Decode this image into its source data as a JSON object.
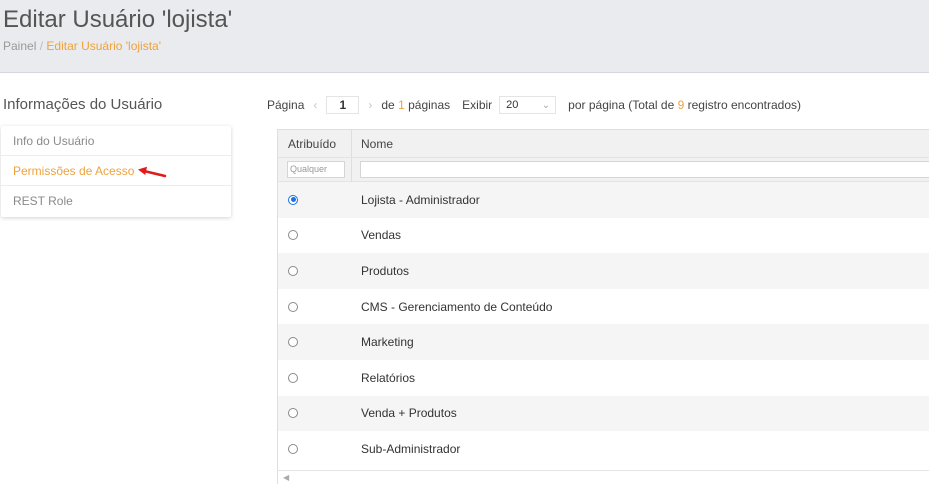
{
  "header": {
    "title": "Editar Usuário 'lojista'",
    "breadcrumb": [
      {
        "label": "Painel"
      },
      {
        "label": "Editar Usuário 'lojista'"
      }
    ],
    "separator": "/"
  },
  "sidebar": {
    "title": "Informações do Usuário",
    "items": [
      {
        "label": "Info do Usuário",
        "active": false
      },
      {
        "label": "Permissões de Acesso",
        "active": true
      },
      {
        "label": "REST Role",
        "active": false
      }
    ]
  },
  "pager": {
    "page_label": "Página",
    "current_page": "1",
    "of_label": "de",
    "total_pages": "1",
    "pages_label": "páginas",
    "show_label": "Exibir",
    "per_page": "20",
    "per_page_label": "por página (Total de",
    "total_records": "9",
    "records_label": "registro encontrados)"
  },
  "grid": {
    "columns": [
      "Atribuído",
      "Nome"
    ],
    "filter_placeholder": "Qualquer",
    "rows": [
      {
        "name": "Lojista - Administrador",
        "assigned": true
      },
      {
        "name": "Vendas",
        "assigned": false
      },
      {
        "name": "Produtos",
        "assigned": false
      },
      {
        "name": "CMS - Gerenciamento de Conteúdo",
        "assigned": false
      },
      {
        "name": "Marketing",
        "assigned": false
      },
      {
        "name": "Relatórios",
        "assigned": false
      },
      {
        "name": "Venda + Produtos",
        "assigned": false
      },
      {
        "name": "Sub-Administrador",
        "assigned": false
      }
    ]
  },
  "colors": {
    "accent": "#f0a23c",
    "radio_checked": "#1a73e8",
    "annotation_arrow": "#e01b1b"
  },
  "icons": [
    "chevron-left-icon",
    "chevron-right-icon",
    "chevron-down-icon",
    "red-arrow-icon",
    "scroll-left-icon"
  ]
}
